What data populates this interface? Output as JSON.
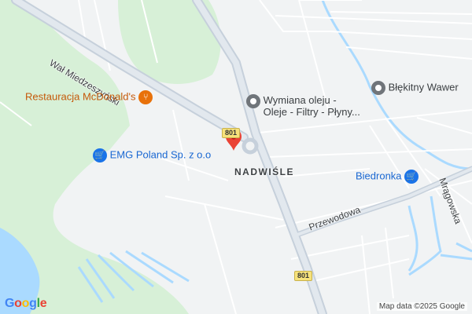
{
  "colors": {
    "land": "#f1f3f4",
    "green": "#d7f0d7",
    "water": "#aadaff",
    "road_major": "#c6d0db",
    "road_minor": "#ffffff",
    "food_poi": "#e8710a",
    "shop_poi": "#1a73e8",
    "generic_poi": "#70757a",
    "pin": "#ea4335"
  },
  "pois": [
    {
      "label": "Restauracja McDonald's",
      "icon": "fork-knife-icon",
      "color": "#e8710a"
    },
    {
      "label": "EMG Poland Sp. z o.o",
      "icon": "shopping-cart-icon",
      "color": "#1a73e8"
    },
    {
      "label": "Wymiana oleju -",
      "label2": "Oleje - Filtry - Płyny...",
      "icon": "pin-dot-icon",
      "color": "#70757a"
    },
    {
      "label": "Błękitny Wawer",
      "icon": "pin-dot-icon",
      "color": "#70757a"
    },
    {
      "label": "Biedronka",
      "icon": "shopping-cart-icon",
      "color": "#1a73e8"
    }
  ],
  "roads": {
    "wal": "Wał Miedzeszyński",
    "przewodowa": "Przewodowa",
    "mragowska": "Mrągowska",
    "shield_top": "801",
    "shield_bottom": "801"
  },
  "area": "NADWIŚLE",
  "marker": {
    "icon": "red-pin-icon"
  },
  "attribution": "Map data ©2025 Google",
  "logo": [
    "G",
    "o",
    "o",
    "g",
    "l",
    "e"
  ]
}
